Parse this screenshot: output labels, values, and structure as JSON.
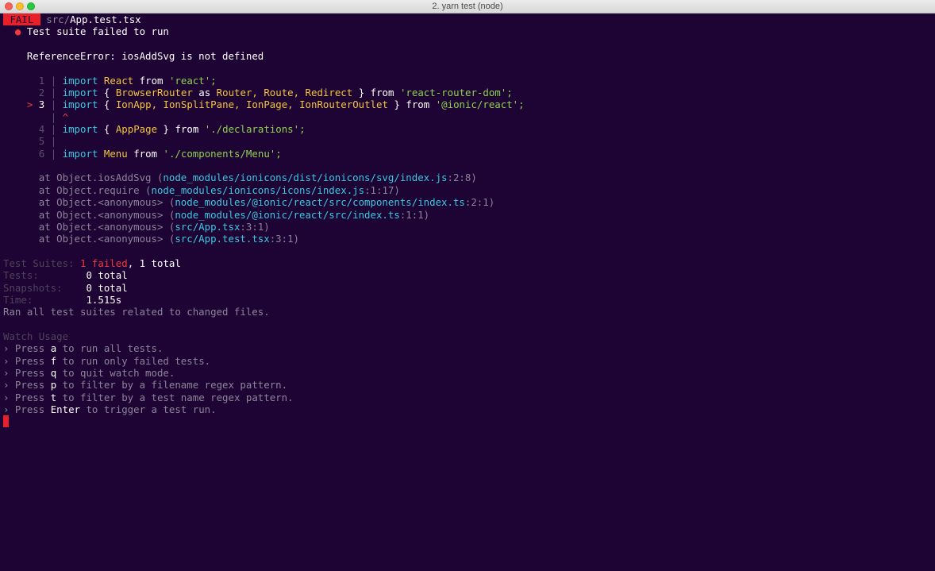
{
  "window": {
    "title": "2. yarn test (node)"
  },
  "header": {
    "badge": "FAIL",
    "path_dir": "src/",
    "path_file": "App.test.tsx"
  },
  "suite": {
    "bullet": "●",
    "message": "Test suite failed to run",
    "error": "ReferenceError: iosAddSvg is not defined"
  },
  "code": {
    "line1": {
      "num": "1",
      "kw": "import",
      "ident": "React",
      "from": "from",
      "str": "'react';"
    },
    "line2": {
      "num": "2",
      "kw": "import",
      "open": "{",
      "a": "BrowserRouter",
      "as": "as",
      "b": "Router, Route, Redirect",
      "close": "}",
      "from": "from",
      "str": "'react-router-dom';"
    },
    "line3": {
      "marker": ">",
      "num": "3",
      "kw": "import",
      "open": "{",
      "names": "IonApp, IonSplitPane, IonPage, IonRouterOutlet",
      "close": "}",
      "from": "from",
      "str": "'@ionic/react';"
    },
    "caret": "^",
    "line4": {
      "num": "4",
      "kw": "import",
      "open": "{",
      "ident": "AppPage",
      "close": "}",
      "from": "from",
      "str": "'./declarations';"
    },
    "line5": {
      "num": "5"
    },
    "line6": {
      "num": "6",
      "kw": "import",
      "ident": "Menu",
      "from": "from",
      "str": "'./components/Menu';"
    },
    "separator": "|"
  },
  "stack": [
    {
      "at": "at Object.iosAddSvg (",
      "file": "node_modules/ionicons/dist/ionicons/svg/index.js",
      "pos": ":2:8)"
    },
    {
      "at": "at Object.require (",
      "file": "node_modules/ionicons/icons/index.js",
      "pos": ":1:17)"
    },
    {
      "at": "at Object.<anonymous> (",
      "file": "node_modules/@ionic/react/src/components/index.ts",
      "pos": ":2:1)"
    },
    {
      "at": "at Object.<anonymous> (",
      "file": "node_modules/@ionic/react/src/index.ts",
      "pos": ":1:1)"
    },
    {
      "at": "at Object.<anonymous> (",
      "file": "src/App.tsx",
      "pos": ":3:1)"
    },
    {
      "at": "at Object.<anonymous> (",
      "file": "src/App.test.tsx",
      "pos": ":3:1)"
    }
  ],
  "summary": {
    "suites_label": "Test Suites:",
    "suites_failed": "1 failed",
    "suites_total": ", 1 total",
    "tests_label": "Tests:",
    "tests_value": "0 total",
    "snapshots_label": "Snapshots:",
    "snapshots_value": "0 total",
    "time_label": "Time:",
    "time_value": "1.515s",
    "ran": "Ran all test suites related to changed files."
  },
  "watch": {
    "title": "Watch Usage",
    "items": [
      {
        "pre": "› Press ",
        "key": "a",
        "post": " to run all tests."
      },
      {
        "pre": "› Press ",
        "key": "f",
        "post": " to run only failed tests."
      },
      {
        "pre": "› Press ",
        "key": "q",
        "post": " to quit watch mode."
      },
      {
        "pre": "› Press ",
        "key": "p",
        "post": " to filter by a filename regex pattern."
      },
      {
        "pre": "› Press ",
        "key": "t",
        "post": " to filter by a test name regex pattern."
      },
      {
        "pre": "› Press ",
        "key": "Enter",
        "post": " to trigger a test run."
      }
    ]
  },
  "colors": {
    "background": "#1e0434",
    "fail": "#e8202a",
    "cyan": "#3cc9df",
    "yellow": "#f2c53d",
    "green": "#8fd14f"
  }
}
